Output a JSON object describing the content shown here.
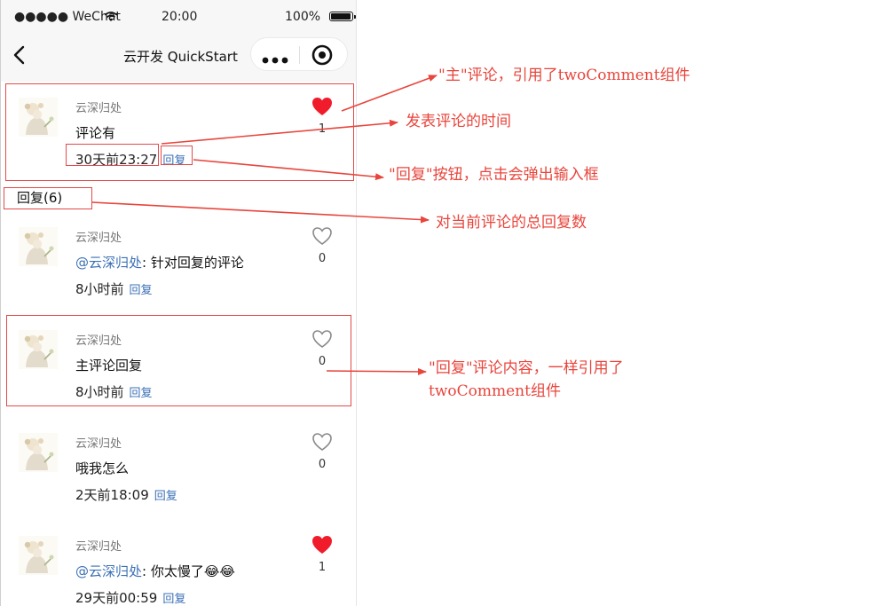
{
  "status_bar": {
    "carrier": "●●●●● WeChat",
    "time": "20:00",
    "battery": "100%"
  },
  "nav": {
    "title": "云开发 QuickStart"
  },
  "main_comment": {
    "username": "云深归处",
    "text": "评论有",
    "time": "30天前23:27",
    "reply_label": "回复",
    "likes": "1",
    "liked": true
  },
  "reply_count_label": "回复(6)",
  "replies": [
    {
      "username": "云深归处",
      "mention": "@云深归处",
      "text": ": 针对回复的评论",
      "time": "8小时前",
      "reply_label": "回复",
      "likes": "0",
      "liked": false
    },
    {
      "username": "云深归处",
      "mention": "",
      "text": "主评论回复",
      "time": "8小时前",
      "reply_label": "回复",
      "likes": "0",
      "liked": false
    },
    {
      "username": "云深归处",
      "mention": "",
      "text": "哦我怎么",
      "time": "2天前18:09",
      "reply_label": "回复",
      "likes": "0",
      "liked": false
    },
    {
      "username": "云深归处",
      "mention": "@云深归处",
      "text": ": 你太慢了😂😂",
      "time": "29天前00:59",
      "reply_label": "回复",
      "likes": "1",
      "liked": true
    }
  ],
  "annotations": {
    "main": "\"主\"评论，引用了twoComment组件",
    "time": "发表评论的时间",
    "reply_button": "\"回复\"按钮，点击会弹出输入框",
    "total": "对当前评论的总回复数",
    "reply_content_line1": "\"回复\"评论内容，一样引用了",
    "reply_content_line2": "twoComment组件"
  },
  "colors": {
    "annotation": "#e8453c",
    "link": "#3b6fb6",
    "heart_liked": "#f01c2c"
  }
}
